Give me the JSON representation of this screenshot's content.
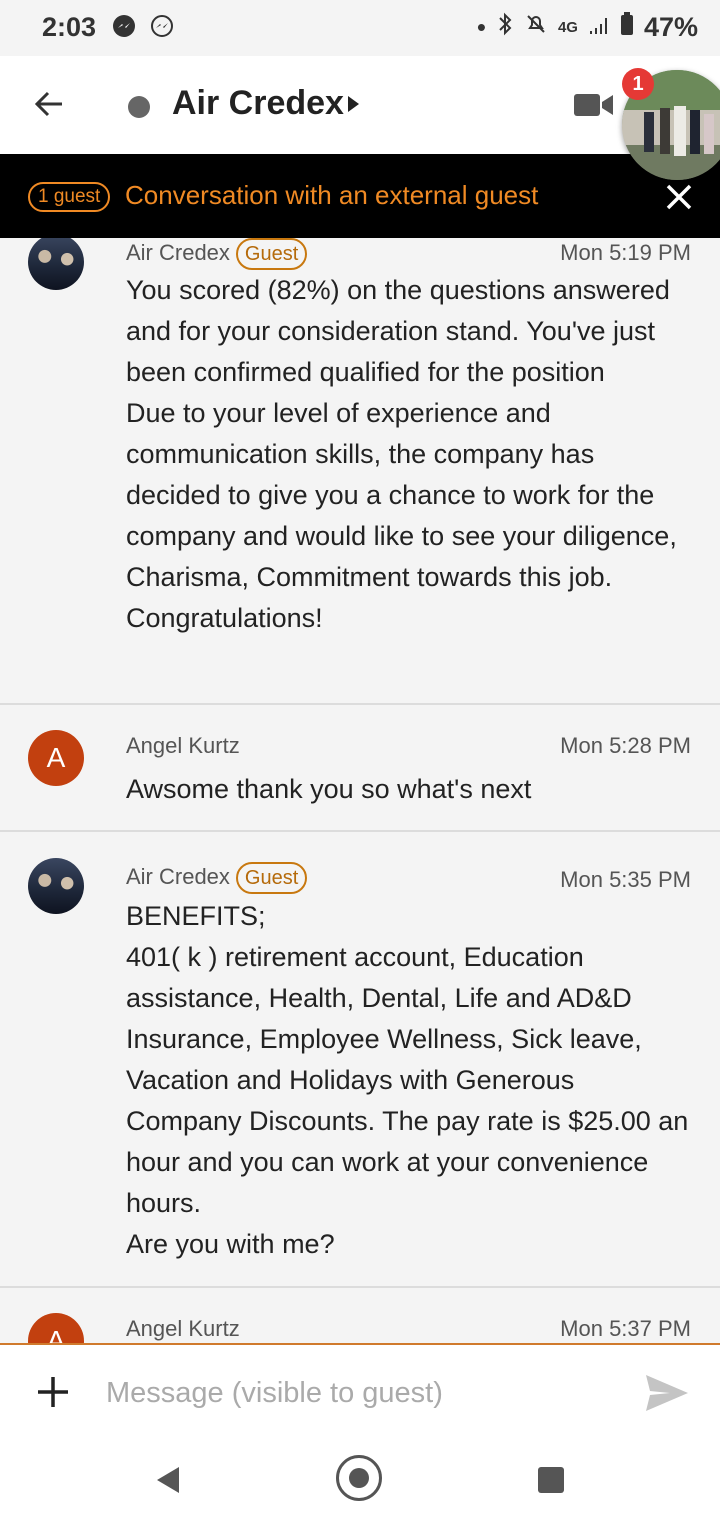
{
  "status_bar": {
    "time": "2:03",
    "network": "4G",
    "battery": "47%"
  },
  "header": {
    "title": "Air Credex",
    "notification_count": "1"
  },
  "guest_banner": {
    "pill": "1 guest",
    "text": "Conversation with an external guest"
  },
  "messages": [
    {
      "sender": "Air Credex",
      "tag": "Guest",
      "time": "Mon 5:19 PM",
      "lines": [
        "You scored (82%) on the questions answered and for your consideration stand. You've just been confirmed qualified for the position",
        "Due to your level of experience and communication skills,  the company has decided to give you a chance to work for the company and  would like to see your diligence, Charisma, Commitment towards this job. Congratulations!"
      ]
    },
    {
      "sender": "Angel Kurtz",
      "avatar_letter": "A",
      "time": "Mon 5:28 PM",
      "lines": [
        "Awsome thank you so what's next"
      ]
    },
    {
      "sender": "Air Credex",
      "tag": "Guest",
      "time": "Mon 5:35 PM",
      "lines": [
        "BENEFITS;",
        "401( k ) retirement account, Education assistance, Health, Dental, Life and AD&D Insurance, Employee Wellness, Sick leave, Vacation and Holidays with Generous Company Discounts. The pay rate is $25.00 an hour and you can work at your convenience hours.",
        "Are you with me?"
      ]
    },
    {
      "sender": "Angel Kurtz",
      "avatar_letter": "A",
      "time": "Mon 5:37 PM"
    }
  ],
  "composer": {
    "placeholder": "Message (visible to guest)"
  },
  "colors": {
    "accent": "#f08a24",
    "avatar_letter_bg": "#c2400f",
    "banner_bg": "#000000"
  }
}
